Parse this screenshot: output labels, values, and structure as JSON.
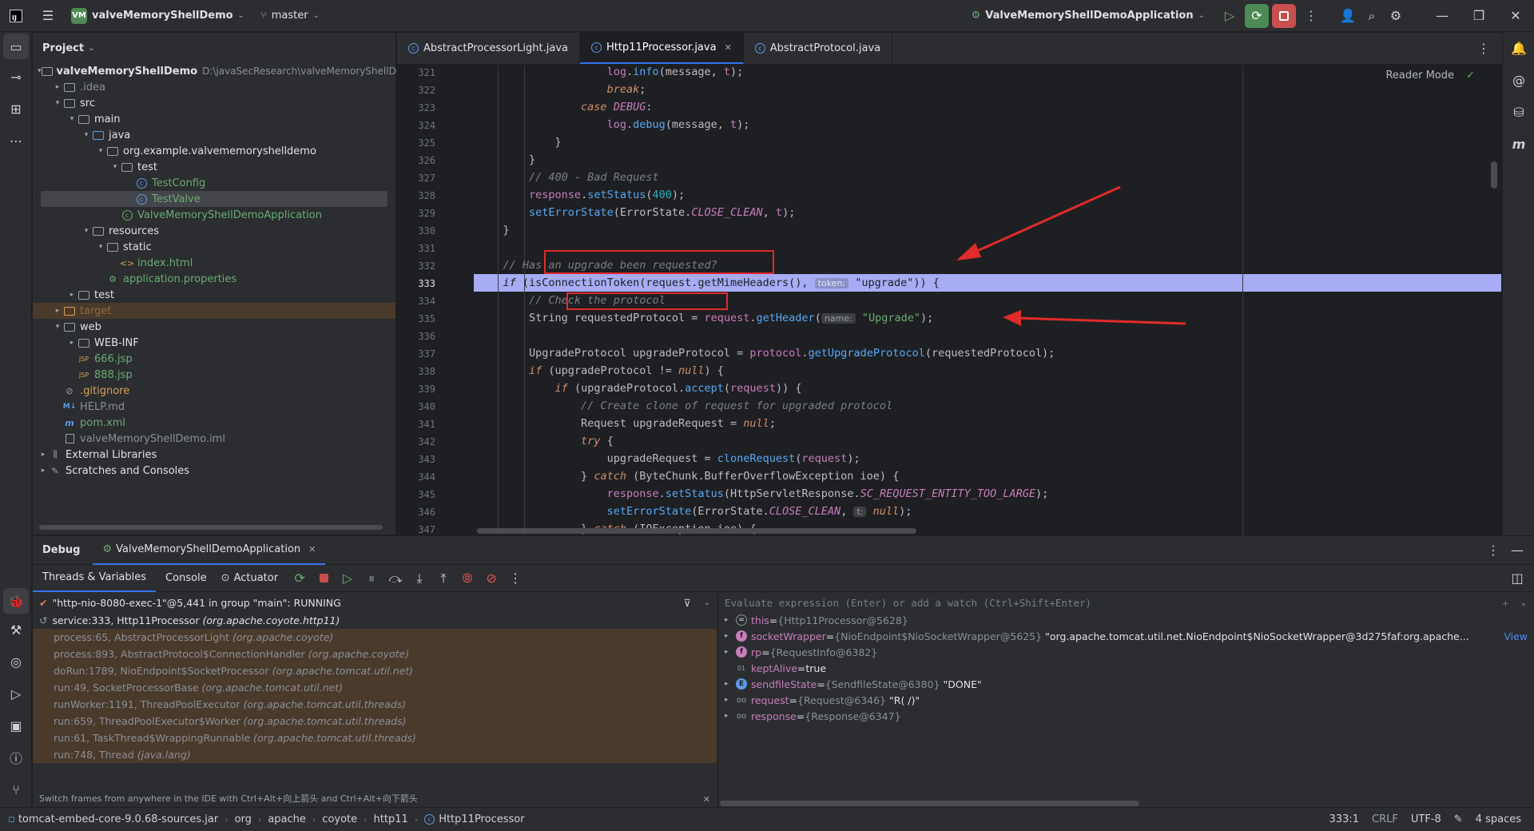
{
  "titlebar": {
    "project_badge": "VM",
    "project_name": "valveMemoryShellDemo",
    "branch": "master",
    "run_config": "ValveMemoryShellDemoApplication"
  },
  "project_panel": {
    "title": "Project",
    "tree": [
      {
        "depth": 0,
        "arrow": "open",
        "icon": "module",
        "label": "valveMemoryShellDemo",
        "extra": "D:\\javaSecResearch\\valveMemoryShellDe",
        "style": "bold"
      },
      {
        "depth": 1,
        "arrow": "closed",
        "icon": "folder",
        "label": ".idea",
        "style": "dim"
      },
      {
        "depth": 1,
        "arrow": "open",
        "icon": "folder",
        "label": "src",
        "style": "normal"
      },
      {
        "depth": 2,
        "arrow": "open",
        "icon": "folder",
        "label": "main",
        "style": "normal"
      },
      {
        "depth": 3,
        "arrow": "open",
        "icon": "folder-blue",
        "label": "java",
        "style": "normal"
      },
      {
        "depth": 4,
        "arrow": "open",
        "icon": "package",
        "label": "org.example.valvememoryshelldemo",
        "style": "normal"
      },
      {
        "depth": 5,
        "arrow": "open",
        "icon": "package",
        "label": "test",
        "style": "normal"
      },
      {
        "depth": 6,
        "arrow": "none",
        "icon": "class",
        "label": "TestConfig",
        "style": "green"
      },
      {
        "depth": 6,
        "arrow": "none",
        "icon": "class",
        "label": "TestValve",
        "style": "green-selected"
      },
      {
        "depth": 5,
        "arrow": "none",
        "icon": "class-app",
        "label": "ValveMemoryShellDemoApplication",
        "style": "green"
      },
      {
        "depth": 3,
        "arrow": "open",
        "icon": "folder",
        "label": "resources",
        "style": "normal"
      },
      {
        "depth": 4,
        "arrow": "open",
        "icon": "folder",
        "label": "static",
        "style": "normal"
      },
      {
        "depth": 5,
        "arrow": "none",
        "icon": "html",
        "label": "index.html",
        "style": "green"
      },
      {
        "depth": 4,
        "arrow": "none",
        "icon": "props",
        "label": "application.properties",
        "style": "green"
      },
      {
        "depth": 2,
        "arrow": "closed",
        "icon": "folder",
        "label": "test",
        "style": "normal"
      },
      {
        "depth": 1,
        "arrow": "closed",
        "icon": "folder-orange",
        "label": "target",
        "style": "excluded"
      },
      {
        "depth": 1,
        "arrow": "open",
        "icon": "folder",
        "label": "web",
        "style": "normal"
      },
      {
        "depth": 2,
        "arrow": "closed",
        "icon": "folder",
        "label": "WEB-INF",
        "style": "normal"
      },
      {
        "depth": 2,
        "arrow": "none",
        "icon": "jsp",
        "label": "666.jsp",
        "style": "green"
      },
      {
        "depth": 2,
        "arrow": "none",
        "icon": "jsp",
        "label": "888.jsp",
        "style": "green"
      },
      {
        "depth": 1,
        "arrow": "none",
        "icon": "ignore",
        "label": ".gitignore",
        "style": "orange"
      },
      {
        "depth": 1,
        "arrow": "none",
        "icon": "md",
        "label": "HELP.md",
        "style": "dim"
      },
      {
        "depth": 1,
        "arrow": "none",
        "icon": "maven",
        "label": "pom.xml",
        "style": "green"
      },
      {
        "depth": 1,
        "arrow": "none",
        "icon": "iml",
        "label": "valveMemoryShellDemo.iml",
        "style": "dim"
      },
      {
        "depth": 0,
        "arrow": "closed",
        "icon": "libs",
        "label": "External Libraries",
        "style": "normal"
      },
      {
        "depth": 0,
        "arrow": "closed",
        "icon": "scratch",
        "label": "Scratches and Consoles",
        "style": "normal"
      }
    ]
  },
  "editor": {
    "tabs": [
      {
        "label": "AbstractProcessorLight.java",
        "active": false
      },
      {
        "label": "Http11Processor.java",
        "active": true
      },
      {
        "label": "AbstractProtocol.java",
        "active": false
      }
    ],
    "reader_mode": "Reader Mode",
    "line_numbers": [
      "321",
      "322",
      "323",
      "324",
      "325",
      "326",
      "327",
      "328",
      "329",
      "330",
      "331",
      "332",
      "333",
      "334",
      "335",
      "336",
      "337",
      "338",
      "339",
      "340",
      "341",
      "342",
      "343",
      "344",
      "345",
      "346",
      "347"
    ],
    "hint_token": "token:",
    "hint_name": "name:",
    "hint_t": "t:"
  },
  "debug": {
    "title": "Debug",
    "session": "ValveMemoryShellDemoApplication",
    "tabs": [
      "Threads & Variables",
      "Console",
      "Actuator"
    ],
    "thread": "\"http-nio-8080-exec-1\"@5,441 in group \"main\": RUNNING",
    "frames": [
      {
        "text": "service:333, Http11Processor",
        "pkg": "(org.apache.coyote.http11)",
        "current": true
      },
      {
        "text": "process:65, AbstractProcessorLight",
        "pkg": "(org.apache.coyote)",
        "current": false
      },
      {
        "text": "process:893, AbstractProtocol$ConnectionHandler",
        "pkg": "(org.apache.coyote)",
        "current": false
      },
      {
        "text": "doRun:1789, NioEndpoint$SocketProcessor",
        "pkg": "(org.apache.tomcat.util.net)",
        "current": false
      },
      {
        "text": "run:49, SocketProcessorBase",
        "pkg": "(org.apache.tomcat.util.net)",
        "current": false
      },
      {
        "text": "runWorker:1191, ThreadPoolExecutor",
        "pkg": "(org.apache.tomcat.util.threads)",
        "current": false
      },
      {
        "text": "run:659, ThreadPoolExecutor$Worker",
        "pkg": "(org.apache.tomcat.util.threads)",
        "current": false
      },
      {
        "text": "run:61, TaskThread$WrappingRunnable",
        "pkg": "(org.apache.tomcat.util.threads)",
        "current": false
      },
      {
        "text": "run:748, Thread",
        "pkg": "(java.lang)",
        "current": false
      }
    ],
    "frames_hint": "Switch frames from anywhere in the IDE with Ctrl+Alt+向上箭头 and Ctrl+Alt+向下箭头",
    "eval_placeholder": "Evaluate expression (Enter) or add a watch (Ctrl+Shift+Enter)",
    "variables": [
      {
        "arrow": true,
        "icon": "=",
        "name": "this",
        "type": "{Http11Processor@5628}",
        "value": ""
      },
      {
        "arrow": true,
        "icon": "f",
        "name": "socketWrapper",
        "type": "{NioEndpoint$NioSocketWrapper@5625}",
        "value": "\"org.apache.tomcat.util.net.NioEndpoint$NioSocketWrapper@3d275faf:org.apache...",
        "link": "View"
      },
      {
        "arrow": true,
        "icon": "f",
        "name": "rp",
        "type": "{RequestInfo@6382}",
        "value": ""
      },
      {
        "arrow": false,
        "icon": "01",
        "name": "keptAlive",
        "type": "",
        "value": "true"
      },
      {
        "arrow": true,
        "icon": "E",
        "name": "sendfileState",
        "type": "{SendfileState@6380}",
        "value": "\"DONE\""
      },
      {
        "arrow": true,
        "icon": "oo",
        "name": "request",
        "type": "{Request@6346}",
        "value": "\"R( /)\""
      },
      {
        "arrow": true,
        "icon": "oo",
        "name": "response",
        "type": "{Response@6347}",
        "value": ""
      }
    ]
  },
  "statusbar": {
    "breadcrumbs": [
      "tomcat-embed-core-9.0.68-sources.jar",
      "org",
      "apache",
      "coyote",
      "http11",
      "Http11Processor"
    ],
    "position": "333:1",
    "line_sep": "CRLF",
    "encoding": "UTF-8",
    "indent": "4 spaces"
  },
  "colors": {
    "accent": "#3574f0",
    "annotation_red": "#e02b2b",
    "exec_line": "#a7acf5"
  }
}
